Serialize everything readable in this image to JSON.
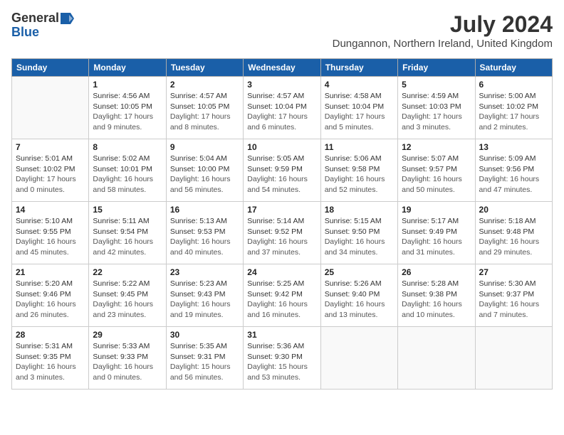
{
  "header": {
    "logo_general": "General",
    "logo_blue": "Blue",
    "month": "July 2024",
    "location": "Dungannon, Northern Ireland, United Kingdom"
  },
  "weekdays": [
    "Sunday",
    "Monday",
    "Tuesday",
    "Wednesday",
    "Thursday",
    "Friday",
    "Saturday"
  ],
  "days": [
    {
      "num": "",
      "empty": true
    },
    {
      "num": "1",
      "sunrise": "4:56 AM",
      "sunset": "10:05 PM",
      "daylight": "17 hours and 9 minutes."
    },
    {
      "num": "2",
      "sunrise": "4:57 AM",
      "sunset": "10:05 PM",
      "daylight": "17 hours and 8 minutes."
    },
    {
      "num": "3",
      "sunrise": "4:57 AM",
      "sunset": "10:04 PM",
      "daylight": "17 hours and 6 minutes."
    },
    {
      "num": "4",
      "sunrise": "4:58 AM",
      "sunset": "10:04 PM",
      "daylight": "17 hours and 5 minutes."
    },
    {
      "num": "5",
      "sunrise": "4:59 AM",
      "sunset": "10:03 PM",
      "daylight": "17 hours and 3 minutes."
    },
    {
      "num": "6",
      "sunrise": "5:00 AM",
      "sunset": "10:02 PM",
      "daylight": "17 hours and 2 minutes."
    },
    {
      "num": "7",
      "sunrise": "5:01 AM",
      "sunset": "10:02 PM",
      "daylight": "17 hours and 0 minutes."
    },
    {
      "num": "8",
      "sunrise": "5:02 AM",
      "sunset": "10:01 PM",
      "daylight": "16 hours and 58 minutes."
    },
    {
      "num": "9",
      "sunrise": "5:04 AM",
      "sunset": "10:00 PM",
      "daylight": "16 hours and 56 minutes."
    },
    {
      "num": "10",
      "sunrise": "5:05 AM",
      "sunset": "9:59 PM",
      "daylight": "16 hours and 54 minutes."
    },
    {
      "num": "11",
      "sunrise": "5:06 AM",
      "sunset": "9:58 PM",
      "daylight": "16 hours and 52 minutes."
    },
    {
      "num": "12",
      "sunrise": "5:07 AM",
      "sunset": "9:57 PM",
      "daylight": "16 hours and 50 minutes."
    },
    {
      "num": "13",
      "sunrise": "5:09 AM",
      "sunset": "9:56 PM",
      "daylight": "16 hours and 47 minutes."
    },
    {
      "num": "14",
      "sunrise": "5:10 AM",
      "sunset": "9:55 PM",
      "daylight": "16 hours and 45 minutes."
    },
    {
      "num": "15",
      "sunrise": "5:11 AM",
      "sunset": "9:54 PM",
      "daylight": "16 hours and 42 minutes."
    },
    {
      "num": "16",
      "sunrise": "5:13 AM",
      "sunset": "9:53 PM",
      "daylight": "16 hours and 40 minutes."
    },
    {
      "num": "17",
      "sunrise": "5:14 AM",
      "sunset": "9:52 PM",
      "daylight": "16 hours and 37 minutes."
    },
    {
      "num": "18",
      "sunrise": "5:15 AM",
      "sunset": "9:50 PM",
      "daylight": "16 hours and 34 minutes."
    },
    {
      "num": "19",
      "sunrise": "5:17 AM",
      "sunset": "9:49 PM",
      "daylight": "16 hours and 31 minutes."
    },
    {
      "num": "20",
      "sunrise": "5:18 AM",
      "sunset": "9:48 PM",
      "daylight": "16 hours and 29 minutes."
    },
    {
      "num": "21",
      "sunrise": "5:20 AM",
      "sunset": "9:46 PM",
      "daylight": "16 hours and 26 minutes."
    },
    {
      "num": "22",
      "sunrise": "5:22 AM",
      "sunset": "9:45 PM",
      "daylight": "16 hours and 23 minutes."
    },
    {
      "num": "23",
      "sunrise": "5:23 AM",
      "sunset": "9:43 PM",
      "daylight": "16 hours and 19 minutes."
    },
    {
      "num": "24",
      "sunrise": "5:25 AM",
      "sunset": "9:42 PM",
      "daylight": "16 hours and 16 minutes."
    },
    {
      "num": "25",
      "sunrise": "5:26 AM",
      "sunset": "9:40 PM",
      "daylight": "16 hours and 13 minutes."
    },
    {
      "num": "26",
      "sunrise": "5:28 AM",
      "sunset": "9:38 PM",
      "daylight": "16 hours and 10 minutes."
    },
    {
      "num": "27",
      "sunrise": "5:30 AM",
      "sunset": "9:37 PM",
      "daylight": "16 hours and 7 minutes."
    },
    {
      "num": "28",
      "sunrise": "5:31 AM",
      "sunset": "9:35 PM",
      "daylight": "16 hours and 3 minutes."
    },
    {
      "num": "29",
      "sunrise": "5:33 AM",
      "sunset": "9:33 PM",
      "daylight": "16 hours and 0 minutes."
    },
    {
      "num": "30",
      "sunrise": "5:35 AM",
      "sunset": "9:31 PM",
      "daylight": "15 hours and 56 minutes."
    },
    {
      "num": "31",
      "sunrise": "5:36 AM",
      "sunset": "9:30 PM",
      "daylight": "15 hours and 53 minutes."
    },
    {
      "num": "",
      "empty": true
    },
    {
      "num": "",
      "empty": true
    },
    {
      "num": "",
      "empty": true
    }
  ]
}
